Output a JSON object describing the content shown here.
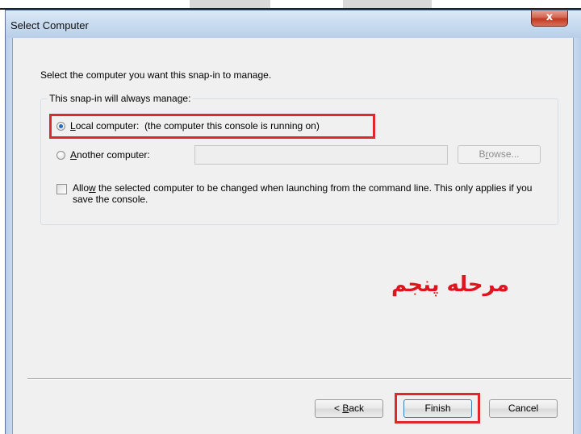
{
  "window": {
    "title": "Select Computer",
    "close_glyph": "x"
  },
  "dialog": {
    "intro": "Select the computer you want this snap-in to manage.",
    "group_label": "This snap-in will always manage:",
    "local_option": {
      "mnemonic": "L",
      "rest": "ocal computer:",
      "suffix": "(the computer this console is running on)",
      "selected": true
    },
    "another_option": {
      "mnemonic": "A",
      "rest": "nother computer:",
      "value": "",
      "selected": false
    },
    "browse_button": {
      "pre": "B",
      "mnemonic": "r",
      "rest": "owse..."
    },
    "allow_checkbox": {
      "pre": "Allo",
      "mnemonic": "w",
      "rest": " the selected computer to be changed when launching from the command line.  This only applies if you save the console.",
      "checked": false
    },
    "annotation": "مرحله پنجم"
  },
  "footer": {
    "back": {
      "pre": "< ",
      "mnemonic": "B",
      "rest": "ack"
    },
    "finish": "Finish",
    "cancel": "Cancel"
  },
  "colors": {
    "highlight": "#e1262c",
    "radio_selected": "#2a69b8",
    "close_button": "#c2391f"
  }
}
